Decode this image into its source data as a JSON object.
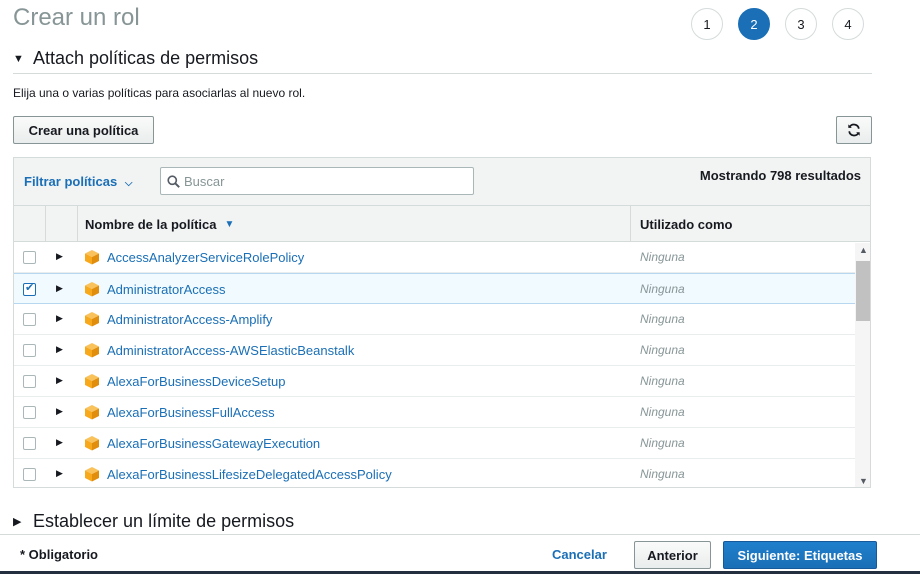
{
  "page": {
    "title": "Crear un rol"
  },
  "steps": [
    "1",
    "2",
    "3",
    "4"
  ],
  "active_step": "2",
  "section1": {
    "title": "Attach políticas de permisos",
    "description": "Elija una o varias políticas para asociarlas al nuevo rol.",
    "create_label": "Crear una política",
    "refresh_icon": "refresh-icon"
  },
  "table": {
    "filter_label": "Filtrar políticas",
    "search_placeholder": "Buscar",
    "results": "Mostrando 798 resultados",
    "col_name": "Nombre de la política",
    "col_used": "Utilizado como",
    "rows": [
      {
        "name": "AccessAnalyzerServiceRolePolicy",
        "used": "Ninguna",
        "checked": false
      },
      {
        "name": "AdministratorAccess",
        "used": "Ninguna",
        "checked": true
      },
      {
        "name": "AdministratorAccess-Amplify",
        "used": "Ninguna",
        "checked": false
      },
      {
        "name": "AdministratorAccess-AWSElasticBeanstalk",
        "used": "Ninguna",
        "checked": false
      },
      {
        "name": "AlexaForBusinessDeviceSetup",
        "used": "Ninguna",
        "checked": false
      },
      {
        "name": "AlexaForBusinessFullAccess",
        "used": "Ninguna",
        "checked": false
      },
      {
        "name": "AlexaForBusinessGatewayExecution",
        "used": "Ninguna",
        "checked": false
      },
      {
        "name": "AlexaForBusinessLifesizeDelegatedAccessPolicy",
        "used": "Ninguna",
        "checked": false
      }
    ]
  },
  "section2": {
    "title": "Establecer un límite de permisos"
  },
  "footer": {
    "required": "* Obligatorio",
    "cancel": "Cancelar",
    "previous": "Anterior",
    "next": "Siguiente: Etiquetas"
  },
  "colors": {
    "accent": "#1a6fb6",
    "policy_icon": "#f7a81b",
    "muted": "#879596"
  }
}
